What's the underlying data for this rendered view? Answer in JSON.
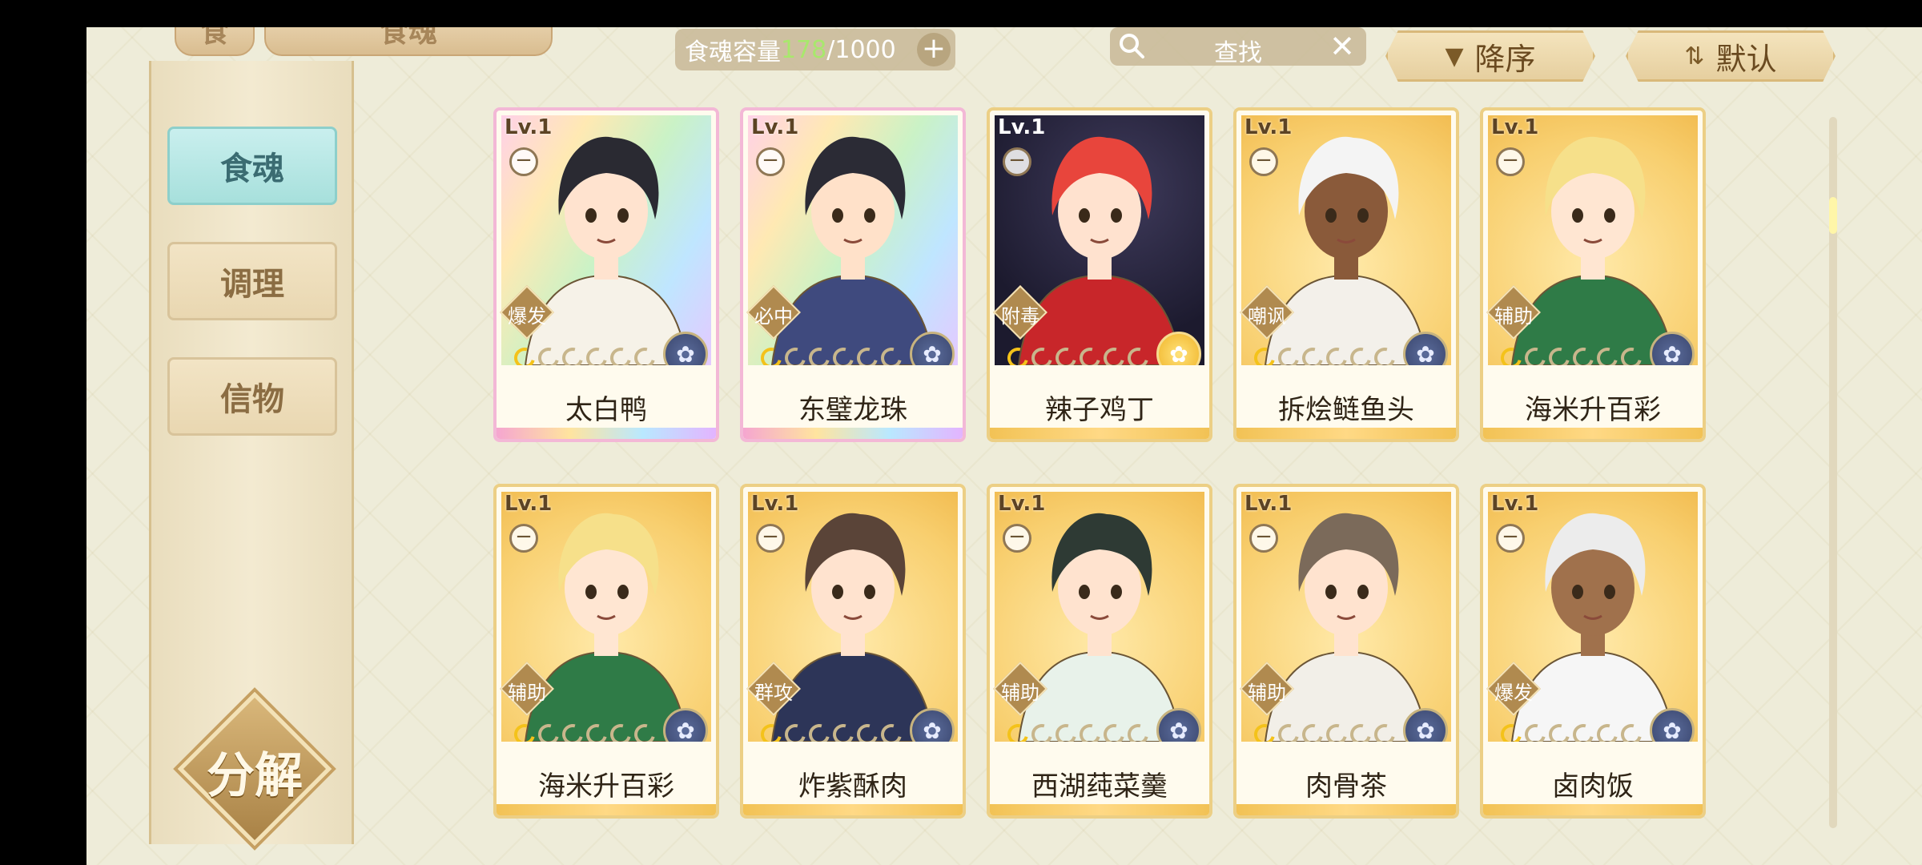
{
  "topbar": {
    "tab_left": "食",
    "tab_title": "食魂",
    "capacity_label": "食魂容量",
    "capacity_current": "178",
    "capacity_max": "/1000",
    "plus": "+",
    "search_text": "查找",
    "search_clear": "✕",
    "sort_desc_label": "降序",
    "sort_default_label": "默认"
  },
  "sidebar": {
    "items": [
      {
        "label": "食魂",
        "active": true
      },
      {
        "label": "调理",
        "active": false
      },
      {
        "label": "信物",
        "active": false
      }
    ],
    "decompose_label": "分解"
  },
  "cards": [
    {
      "level": "Lv.1",
      "name": "太白鸭",
      "role": "爆发",
      "frame": "rainbow",
      "stars": 1,
      "emblem": "blue"
    },
    {
      "level": "Lv.1",
      "name": "东璧龙珠",
      "role": "必中",
      "frame": "rainbow",
      "stars": 1,
      "emblem": "blue"
    },
    {
      "level": "Lv.1",
      "name": "辣子鸡丁",
      "role": "附毒",
      "frame": "dark",
      "stars": 1,
      "emblem": "gold"
    },
    {
      "level": "Lv.1",
      "name": "拆烩鲢鱼头",
      "role": "嘲讽",
      "frame": "gold",
      "stars": 1,
      "emblem": "blue"
    },
    {
      "level": "Lv.1",
      "name": "海米升百彩",
      "role": "辅助",
      "frame": "gold",
      "stars": 1,
      "emblem": "blue"
    },
    {
      "level": "Lv.1",
      "name": "海米升百彩",
      "role": "辅助",
      "frame": "gold",
      "stars": 1,
      "emblem": "blue"
    },
    {
      "level": "Lv.1",
      "name": "炸紫酥肉",
      "role": "群攻",
      "frame": "gold",
      "stars": 1,
      "emblem": "blue"
    },
    {
      "level": "Lv.1",
      "name": "西湖莼菜羹",
      "role": "辅助",
      "frame": "gold",
      "stars": 1,
      "emblem": "blue"
    },
    {
      "level": "Lv.1",
      "name": "肉骨茶",
      "role": "辅助",
      "frame": "gold",
      "stars": 1,
      "emblem": "blue"
    },
    {
      "level": "Lv.1",
      "name": "卤肉饭",
      "role": "爆发",
      "frame": "gold",
      "stars": 1,
      "emblem": "blue"
    }
  ],
  "colors": {
    "background": "#eeecd9",
    "accent_teal": "#a7e0dc",
    "gold_frame": "#eccf85",
    "capacity_highlight": "#a8e86c"
  }
}
